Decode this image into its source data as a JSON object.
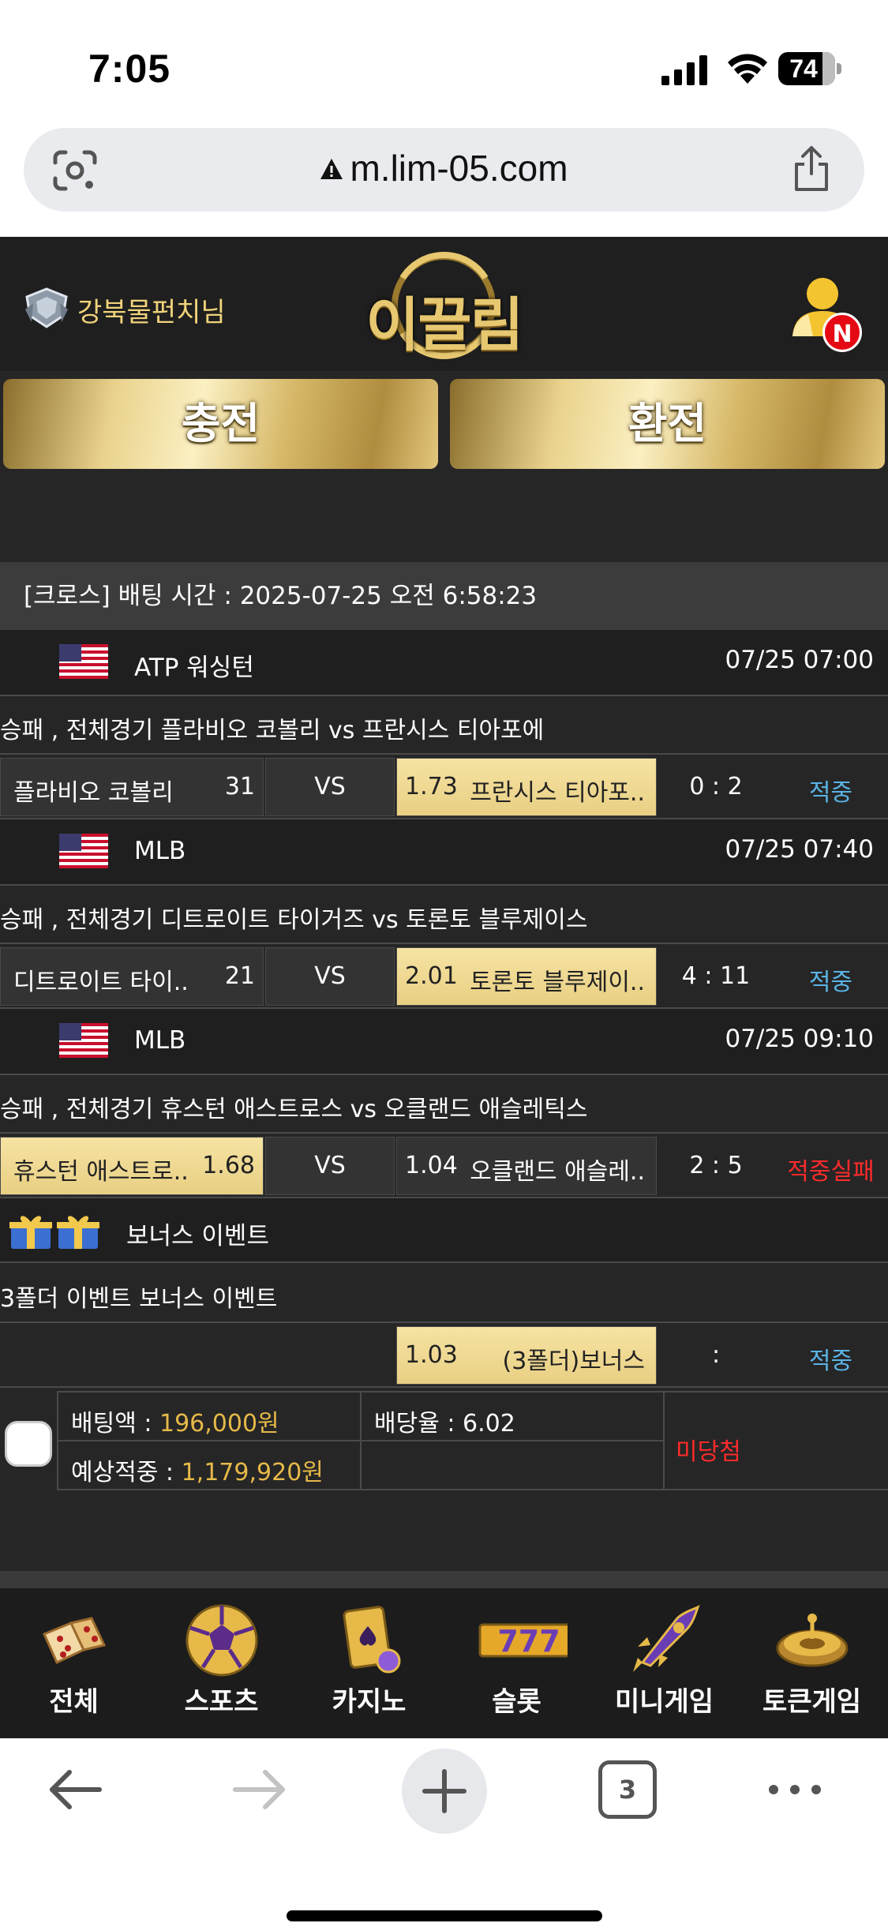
{
  "status_bar": {
    "time": "7:05",
    "battery": "74"
  },
  "browser": {
    "url": "m.lim-05.com",
    "tab_count": "3"
  },
  "header": {
    "username": "강북물펀치",
    "suffix": "님",
    "logo": "이끌림",
    "notification_badge": "N"
  },
  "actions": {
    "charge": "충전",
    "exchange": "환전"
  },
  "slip": {
    "heading": "[크로스] 배팅 시간 : 2025-07-25 오전 6:58:23",
    "games": [
      {
        "league": "ATP 워싱턴",
        "time": "07/25 07:00",
        "title": "승패 , 전체경기 플라비오 코볼리  vs  프란시스 티아포에",
        "home": "플라비오 코볼리",
        "home_odds": "31",
        "vs": "VS",
        "away_odds": "1.73",
        "away": "프란시스 티아포..",
        "score": "0 : 2",
        "result": "적중"
      },
      {
        "league": "MLB",
        "time": "07/25 07:40",
        "title": "승패 , 전체경기 디트로이트 타이거즈  vs  토론토 블루제이스",
        "home": "디트로이트 타이..",
        "home_odds": "21",
        "vs": "VS",
        "away_odds": "2.01",
        "away": "토론토 블루제이..",
        "score": "4 : 11",
        "result": "적중"
      },
      {
        "league": "MLB",
        "time": "07/25 09:10",
        "title": "승패 , 전체경기 휴스턴 애스트로스  vs  오클랜드 애슬레틱스",
        "home": "휴스턴 애스트로..",
        "home_odds": "1.68",
        "vs": "VS",
        "away_odds": "1.04",
        "away": "오클랜드 애슬레..",
        "score": "2 : 5",
        "result": "적중실패"
      }
    ],
    "bonus": {
      "label": "보너스 이벤트",
      "title": "3폴더 이벤트 보너스 이벤트",
      "odds": "1.03",
      "name": "(3폴더)보너스",
      "score": ":",
      "result": "적중"
    },
    "summary": {
      "bet_label": "배팅액 : ",
      "bet_amount": "196,000원",
      "rate_label": "배당율 : 6.02",
      "expected_label": "예상적중 : ",
      "expected_amount": "1,179,920원",
      "status": "미당첨"
    }
  },
  "game_nav": [
    {
      "label": "전체",
      "icon": "dice-icon"
    },
    {
      "label": "스포츠",
      "icon": "soccer-ball-icon"
    },
    {
      "label": "카지노",
      "icon": "cards-icon"
    },
    {
      "label": "슬롯",
      "icon": "slot-777-icon"
    },
    {
      "label": "미니게임",
      "icon": "rocket-icon"
    },
    {
      "label": "토큰게임",
      "icon": "roulette-icon"
    }
  ],
  "colors": {
    "gold": "#e6b949",
    "hit": "#5ab4e6",
    "miss": "#ff2b2b",
    "background": "#262626"
  }
}
